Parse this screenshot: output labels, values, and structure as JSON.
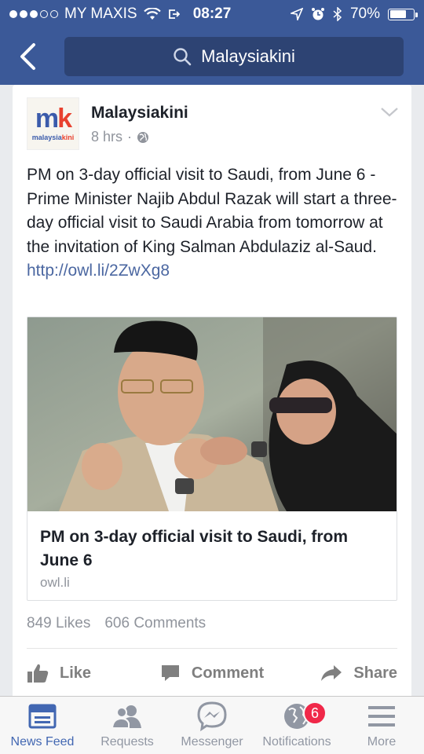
{
  "status_bar": {
    "carrier": "MY MAXIS",
    "time": "08:27",
    "battery_percent": "70%",
    "battery_level": 0.7
  },
  "nav": {
    "search_text": "Malaysiakini"
  },
  "post": {
    "logo_text_a": "malaysia",
    "logo_text_b": "kini",
    "logo_mark_m": "m",
    "logo_mark_k": "k",
    "page_name": "Malaysiakini",
    "time": "8 hrs",
    "dot": "·",
    "text": "PM on 3-day official visit to Saudi, from June 6 - Prime Minister Najib Abdul Razak will start a three-day official visit to Saudi Arabia from tomorrow at the invitation of King Salman Abdulaziz al-Saud. ",
    "link": "http://owl.li/2ZwXg8",
    "preview": {
      "title": "PM on 3-day official visit to Saudi, from June 6",
      "domain": "owl.li"
    },
    "likes": "849 Likes",
    "comments": "606 Comments",
    "actions": {
      "like": "Like",
      "comment": "Comment",
      "share": "Share"
    }
  },
  "tabs": [
    {
      "label": "News Feed",
      "icon": "news-feed-icon"
    },
    {
      "label": "Requests",
      "icon": "requests-icon"
    },
    {
      "label": "Messenger",
      "icon": "messenger-icon"
    },
    {
      "label": "Notifications",
      "icon": "notifications-icon",
      "badge": "6"
    },
    {
      "label": "More",
      "icon": "more-icon"
    }
  ],
  "colors": {
    "brand": "#3b5998",
    "active_tab": "#4267b2",
    "badge": "#f02849",
    "link": "#4b67a1"
  }
}
